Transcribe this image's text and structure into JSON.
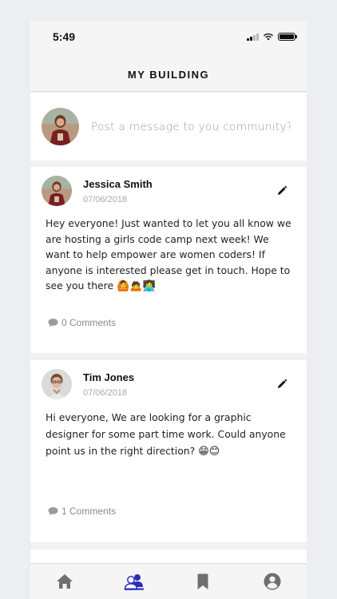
{
  "status_bar": {
    "time": "5:49"
  },
  "header": {
    "title": "MY BUILDING"
  },
  "compose": {
    "placeholder": "Post a message to you community?"
  },
  "posts": [
    {
      "author": "Jessica Smith",
      "date": "07/06/2018",
      "text": "Hey everyone! Just wanted to let you all know we are hosting a girls code camp next week! We want to help empower are women coders! If anyone is interested please get in touch. Hope to see you there",
      "emojis": "🙆🙇👩‍💻",
      "comments": "0 Comments"
    },
    {
      "author": "Tim Jones",
      "date": "07/06/2018",
      "text": "Hi everyone, We are looking for a graphic designer for some part time work. Could anyone point us in the right direction?",
      "emojis": "😁😊",
      "comments": "1 Comments"
    }
  ],
  "tabs": [
    {
      "icon": "home-icon",
      "active": false
    },
    {
      "icon": "community-icon",
      "active": true
    },
    {
      "icon": "bookmark-icon",
      "active": false
    },
    {
      "icon": "profile-icon",
      "active": false
    }
  ],
  "colors": {
    "active_tab": "#2a2fbf",
    "inactive_tab": "#6f6f6f",
    "background": "#eceeef"
  }
}
